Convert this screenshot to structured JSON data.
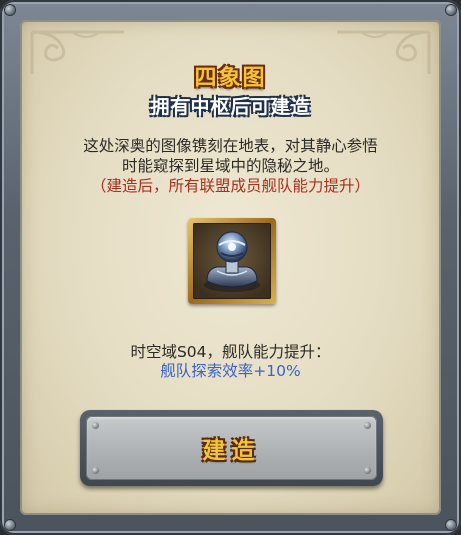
{
  "dialog": {
    "title": "四象图",
    "subtitle": "拥有中枢后可建造",
    "description_line1": "这处深奥的图像镌刻在地表，对其静心参悟",
    "description_line2": "时能窥探到星域中的隐秘之地。",
    "note": "（建造后，所有联盟成员舰队能力提升）",
    "building_icon": "beacon-tower-icon",
    "bonus_label": "时空域S04，舰队能力提升：",
    "bonus_value": "舰队探索效率+10%",
    "build_button_label": "建造"
  },
  "colors": {
    "title": "#f3c33a",
    "note": "#a8311f",
    "bonus_value": "#3a63c8",
    "panel": "#e4dcc2"
  }
}
